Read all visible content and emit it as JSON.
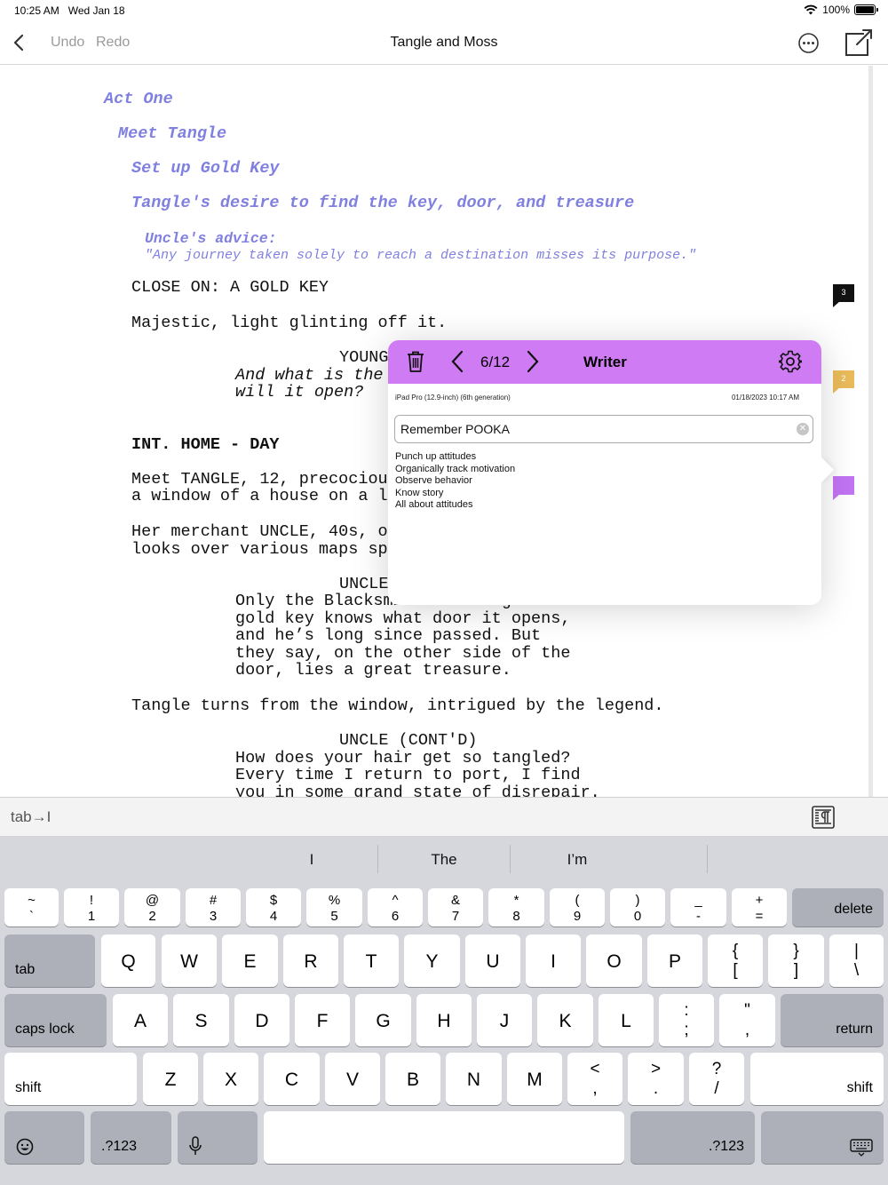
{
  "status_bar": {
    "time": "10:25 AM",
    "date": "Wed Jan 18",
    "battery": "100%",
    "battery_level": 1.0
  },
  "nav": {
    "undo": "Undo",
    "redo": "Redo",
    "title": "Tangle and Moss"
  },
  "script": {
    "outline": [
      "Act One",
      "Meet Tangle",
      "Set up Gold Key",
      "Tangle's desire to find the key, door, and treasure"
    ],
    "note_title": "Uncle's advice:",
    "note_quote": "\"Any journey taken solely to reach a destination misses its purpose.\"",
    "lines": {
      "action1": "CLOSE ON: A GOLD KEY",
      "action2": "Majestic, light glinting off it.",
      "char1": "YOUNG",
      "dial1a": "And what is the",
      "dial1b": "will it open?",
      "scene1": "INT. HOME - DAY",
      "action3a": "Meet TANGLE, 12, precociou",
      "action3b": "a window of a house on a l",
      "action4a": "Her merchant UNCLE, 40s, o",
      "action4b": "looks over various maps sp",
      "char2": "UNCLE",
      "dial2a": "Only the Blacksmith who forged the",
      "dial2b": "gold key knows what door it opens,",
      "dial2c": "and he’s long since passed. But",
      "dial2d": "they say, on the other side of the",
      "dial2e": "door, lies a great treasure.",
      "action5": "Tangle turns from the window, intrigued by the legend.",
      "char3": "UNCLE (CONT'D)",
      "dial3a": "How does your hair get so tangled?",
      "dial3b": "Every time I return to port, I find",
      "dial3c": "you in some grand state of disrepair."
    },
    "markers": [
      "3",
      "2",
      ""
    ],
    "marker_colors": [
      "#111111",
      "#e9bb5a",
      "#c274f2"
    ]
  },
  "note_popover": {
    "counter": "6/12",
    "writer": "Writer",
    "device": "iPad Pro (12.9-inch) (6th generation)",
    "date": "01/18/2023 10:17 AM",
    "title_value": "Remember POOKA",
    "notes": [
      "Punch up attitudes",
      "Organically track motivation",
      "Observe behavior",
      "Know story",
      "All about attitudes"
    ],
    "header_color": "#cf7bf3"
  },
  "toolbar": {
    "tab": "tab→I"
  },
  "keyboard": {
    "suggestions": [
      "I",
      "The",
      "I’m"
    ],
    "row1": [
      [
        "~",
        "`"
      ],
      [
        "!",
        "1"
      ],
      [
        "@",
        "2"
      ],
      [
        "#",
        "3"
      ],
      [
        "$",
        "4"
      ],
      [
        "%",
        "5"
      ],
      [
        "^",
        "6"
      ],
      [
        "&",
        "7"
      ],
      [
        "*",
        "8"
      ],
      [
        "(",
        "9"
      ],
      [
        ")",
        "0"
      ],
      [
        "_",
        "-"
      ],
      [
        "+",
        "="
      ]
    ],
    "delete": "delete",
    "tab": "tab",
    "row2": [
      "Q",
      "W",
      "E",
      "R",
      "T",
      "Y",
      "U",
      "I",
      "O",
      "P"
    ],
    "row2_sym": [
      [
        "{",
        "["
      ],
      [
        "}",
        "]"
      ],
      [
        "|",
        "\\"
      ]
    ],
    "caps": "caps lock",
    "row3": [
      "A",
      "S",
      "D",
      "F",
      "G",
      "H",
      "J",
      "K",
      "L"
    ],
    "row3_sym": [
      [
        ":",
        ";"
      ],
      [
        "\"",
        ","
      ]
    ],
    "return": "return",
    "shift": "shift",
    "row4": [
      "Z",
      "X",
      "C",
      "V",
      "B",
      "N",
      "M"
    ],
    "row4_sym": [
      [
        "<",
        ","
      ],
      [
        ">",
        "."
      ],
      [
        "?",
        "/"
      ]
    ],
    "num": ".?123"
  }
}
